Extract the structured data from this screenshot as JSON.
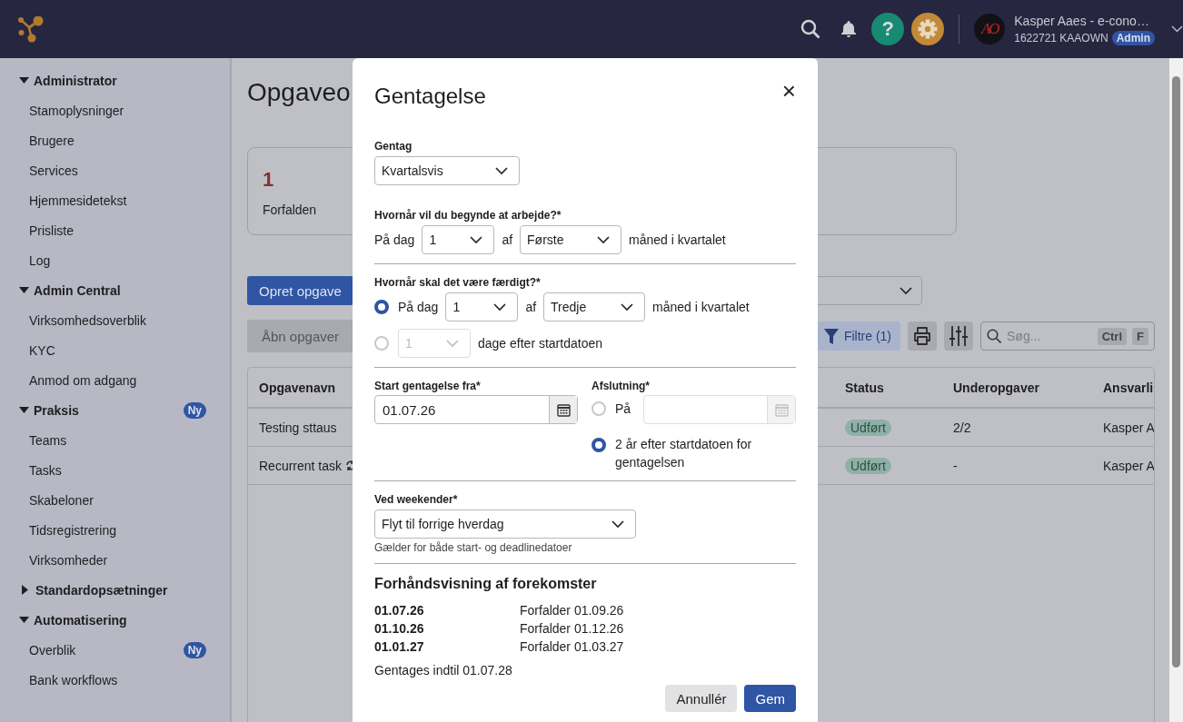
{
  "topbar": {
    "help_button": "?",
    "avatar_text": "AO",
    "user_name": "Kasper Aaes - e-cono…",
    "user_id": "1622721 KAAOWN",
    "role_badge": "Admin"
  },
  "sidebar": {
    "groups": [
      {
        "label": "Administrator",
        "expanded": true,
        "items": [
          {
            "label": "Stamoplysninger"
          },
          {
            "label": "Brugere"
          },
          {
            "label": "Services"
          },
          {
            "label": "Hjemmesidetekst"
          },
          {
            "label": "Prisliste"
          },
          {
            "label": "Log"
          }
        ]
      },
      {
        "label": "Admin Central",
        "expanded": true,
        "items": [
          {
            "label": "Virksomhedsoverblik"
          },
          {
            "label": "KYC"
          },
          {
            "label": "Anmod om adgang"
          }
        ]
      },
      {
        "label": "Praksis",
        "expanded": true,
        "badge": "Ny",
        "items": [
          {
            "label": "Teams"
          },
          {
            "label": "Tasks"
          },
          {
            "label": "Skabeloner"
          },
          {
            "label": "Tidsregistrering"
          },
          {
            "label": "Virksomheder"
          }
        ]
      },
      {
        "label": "Standardopsætninger",
        "expanded": false
      },
      {
        "label": "Automatisering",
        "expanded": true,
        "items": [
          {
            "label": "Overblik",
            "badge": "Ny"
          },
          {
            "label": "Bank workflows"
          }
        ]
      }
    ]
  },
  "main": {
    "page_title": "Opgaveo",
    "summary_card": {
      "count": "1",
      "label": "Forfalden"
    },
    "create_button": "Opret opgave",
    "toolbar": {
      "tab_label": "Åbn opgaver",
      "filter_button": "Filtre (1)",
      "search": {
        "placeholder": "Søg...",
        "shortcut_keys": [
          "Ctrl",
          "F"
        ]
      }
    },
    "table": {
      "columns": [
        "Opgavenavn",
        "Status",
        "Underopgaver",
        "Ansvarli"
      ],
      "rows": [
        {
          "cells": [
            "Testing sttaus",
            "Udført",
            "2/2",
            "Kasper A"
          ],
          "recurring": false
        },
        {
          "cells": [
            "Recurrent task",
            "Udført",
            "-",
            "Kasper A"
          ],
          "recurring": true
        }
      ]
    }
  },
  "dialog": {
    "title": "Gentagelse",
    "close": "×",
    "repeat": {
      "label": "Gentag",
      "value": "Kvartalsvis"
    },
    "start": {
      "label": "Hvornår vil du begynde at arbejde?*",
      "parts": [
        {
          "kind": "text",
          "text": "På dag"
        },
        {
          "kind": "select",
          "value": "1",
          "disabled": false
        },
        {
          "kind": "text",
          "text": "af"
        },
        {
          "kind": "select",
          "value": "Første",
          "disabled": false
        },
        {
          "kind": "text",
          "text": "måned i kvartalet"
        }
      ]
    },
    "finish": {
      "label": "Hvornår skal det være færdigt?*",
      "options": [
        {
          "selected": true,
          "parts": [
            {
              "kind": "text",
              "text": "På dag"
            },
            {
              "kind": "select",
              "value": "1",
              "disabled": false
            },
            {
              "kind": "text",
              "text": "af"
            },
            {
              "kind": "select",
              "value": "Tredje",
              "disabled": false
            },
            {
              "kind": "text",
              "text": "måned i kvartalet"
            }
          ]
        },
        {
          "selected": false,
          "parts": [
            {
              "kind": "select",
              "value": "1",
              "disabled": true
            },
            {
              "kind": "text",
              "text": "dage efter startdatoen"
            }
          ]
        }
      ]
    },
    "start_date": {
      "label": "Start gentagelse fra*",
      "value": "01.07.26"
    },
    "ending": {
      "label": "Afslutning*",
      "options": [
        {
          "kind": "date",
          "text": "På",
          "selected": false,
          "field_disabled": true
        },
        {
          "kind": "text",
          "text": "2 år efter startdatoen for gentagelsen",
          "selected": true
        }
      ]
    },
    "weekend": {
      "label": "Ved weekender*",
      "value": "Flyt til forrige hverdag",
      "help": "Gælder for både start- og deadlinedatoer"
    },
    "preview": {
      "title": "Forhåndsvisning af forekomster",
      "rows": [
        {
          "date": "01.07.26",
          "due": "Forfalder 01.09.26"
        },
        {
          "date": "01.10.26",
          "due": "Forfalder 01.12.26"
        },
        {
          "date": "01.01.27",
          "due": "Forfalder 01.03.27"
        }
      ],
      "summary": "Gentages indtil 01.07.28"
    },
    "buttons": [
      {
        "label": "Annullér",
        "kind": "secondary"
      },
      {
        "label": "Gem",
        "kind": "primary"
      }
    ]
  }
}
